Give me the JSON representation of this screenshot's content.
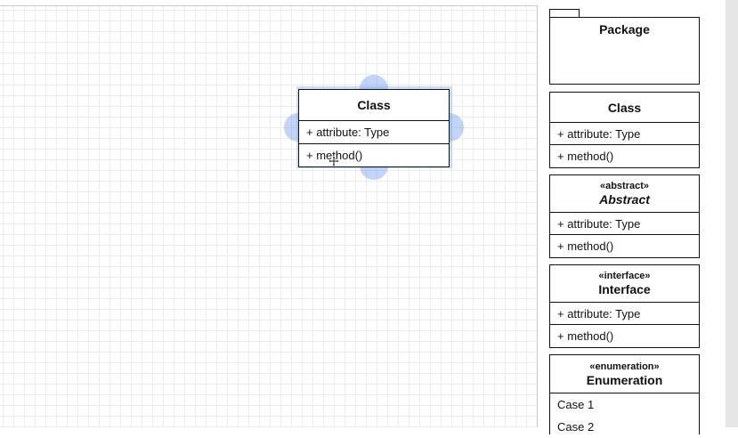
{
  "canvas": {
    "class_box": {
      "name": "Class",
      "attribute": "+ attribute: Type",
      "method": "+ method()"
    }
  },
  "palette": {
    "package": {
      "name": "Package"
    },
    "class": {
      "name": "Class",
      "attribute": "+ attribute: Type",
      "method": "+ method()"
    },
    "abstract": {
      "stereotype": "«abstract»",
      "name": "Abstract",
      "attribute": "+ attribute: Type",
      "method": "+ method()"
    },
    "interface": {
      "stereotype": "«interface»",
      "name": "Interface",
      "attribute": "+ attribute: Type",
      "method": "+ method()"
    },
    "enumeration": {
      "stereotype": "«enumeration»",
      "name": "Enumeration",
      "cases": [
        "Case 1",
        "Case 2"
      ]
    }
  },
  "colors": {
    "selection": "#78a0f0",
    "grid": "#ececec"
  }
}
